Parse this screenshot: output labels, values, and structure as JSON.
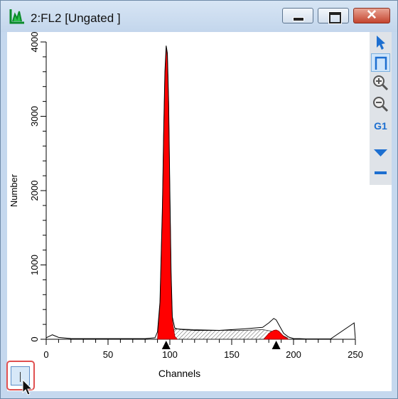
{
  "window": {
    "title": "2:FL2 [Ungated ]",
    "accent": "#c5d8ee",
    "close_color": "#c4452f"
  },
  "toolbar": {
    "tools": [
      "select-arrow-icon",
      "region-gate-icon",
      "zoom-in-icon",
      "zoom-out-icon",
      "gate-g1",
      "dropdown-triangle-icon",
      "minus-icon"
    ],
    "gate_label": "G1"
  },
  "chart_data": {
    "type": "histogram",
    "xlabel": "Channels",
    "ylabel": "Number",
    "xlim": [
      0,
      250
    ],
    "ylim": [
      0,
      4000
    ],
    "x_ticks": [
      0,
      50,
      100,
      150,
      200,
      250
    ],
    "y_ticks": [
      0,
      1000,
      2000,
      3000,
      4000
    ],
    "x_tick_labels": [
      "0",
      "50",
      "100",
      "150",
      "200",
      "250"
    ],
    "y_tick_labels": [
      "0",
      "1000",
      "2000",
      "3000",
      "4000"
    ],
    "fill_color": "#ff0000",
    "histogram": {
      "x": [
        0,
        5,
        10,
        20,
        40,
        60,
        80,
        88,
        90,
        92,
        94,
        95,
        96,
        97,
        98,
        99,
        100,
        101,
        102,
        104,
        106,
        110,
        120,
        140,
        160,
        175,
        180,
        184,
        186,
        188,
        192,
        196,
        200,
        205,
        210,
        230,
        249,
        250
      ],
      "y": [
        20,
        60,
        25,
        10,
        8,
        8,
        8,
        20,
        100,
        500,
        1800,
        2800,
        3600,
        3950,
        3850,
        3200,
        2000,
        900,
        300,
        150,
        140,
        130,
        120,
        120,
        140,
        160,
        220,
        280,
        260,
        200,
        80,
        30,
        10,
        8,
        5,
        5,
        220,
        5
      ]
    },
    "g1_peak": {
      "x": [
        90,
        92,
        94,
        95,
        96,
        97,
        98,
        99,
        100,
        101,
        102,
        104,
        106
      ],
      "y": [
        0,
        450,
        1750,
        2750,
        3550,
        3900,
        3800,
        3150,
        1950,
        850,
        250,
        40,
        0
      ]
    },
    "g2_peak": {
      "x": [
        176,
        180,
        184,
        186,
        188,
        192,
        196
      ],
      "y": [
        0,
        80,
        120,
        125,
        110,
        40,
        0
      ]
    },
    "s_phase": {
      "x": [
        100,
        105,
        120,
        140,
        160,
        175,
        185,
        195
      ],
      "y": [
        100,
        140,
        130,
        120,
        120,
        130,
        100,
        20
      ]
    },
    "markers": [
      97,
      186
    ]
  }
}
